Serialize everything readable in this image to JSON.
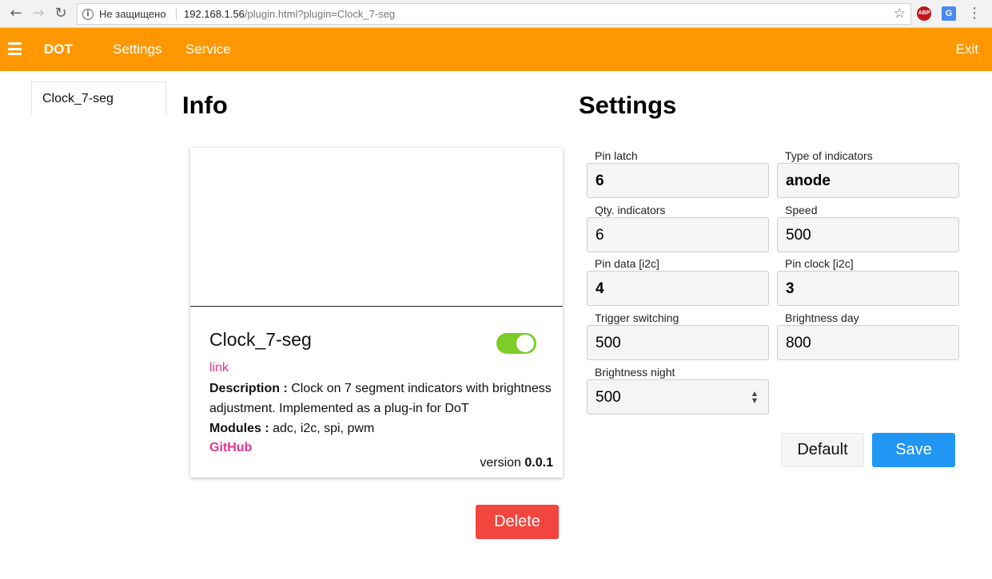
{
  "browser": {
    "security_text": "Не защищено",
    "url_host": "192.168.1.56",
    "url_rest": "/plugin.html?plugin=Clock_7-seg",
    "abp_label": "ABP",
    "translate_label": "G"
  },
  "appbar": {
    "brand": "DOT",
    "nav": [
      "Settings",
      "Service"
    ],
    "exit": "Exit",
    "color": "#ff9800"
  },
  "sidebar": {
    "items": [
      {
        "label": "Clock_7-seg"
      }
    ]
  },
  "info": {
    "heading": "Info",
    "card": {
      "title": "Clock_7-seg",
      "enabled": true,
      "link_label": "link",
      "description_label": "Description :",
      "description": "Clock on 7 segment indicators with brightness adjustment. Implemented as a plug-in for DoT",
      "modules_label": "Modules :",
      "modules": "adc, i2c, spi, pwm",
      "github_label": "GitHub",
      "version_label": "version",
      "version": "0.0.1"
    },
    "delete_label": "Delete"
  },
  "settings": {
    "heading": "Settings",
    "fields": [
      {
        "label": "Pin latch",
        "value": "6"
      },
      {
        "label": "Type of indicators",
        "value": "anode"
      },
      {
        "label": "Qty. indicators",
        "value": "6"
      },
      {
        "label": "Speed",
        "value": "500"
      },
      {
        "label": "Pin data [i2c]",
        "value": "4"
      },
      {
        "label": "Pin clock [i2c]",
        "value": "3"
      },
      {
        "label": "Trigger switching",
        "value": "500"
      },
      {
        "label": "Brightness day",
        "value": "800"
      },
      {
        "label": "Brightness night",
        "value": "500"
      }
    ],
    "default_label": "Default",
    "save_label": "Save"
  },
  "colors": {
    "accent": "#ff9800",
    "toggle_on": "#7ccd28",
    "link": "#e0338e",
    "delete": "#f1453d",
    "save": "#2196f3"
  }
}
